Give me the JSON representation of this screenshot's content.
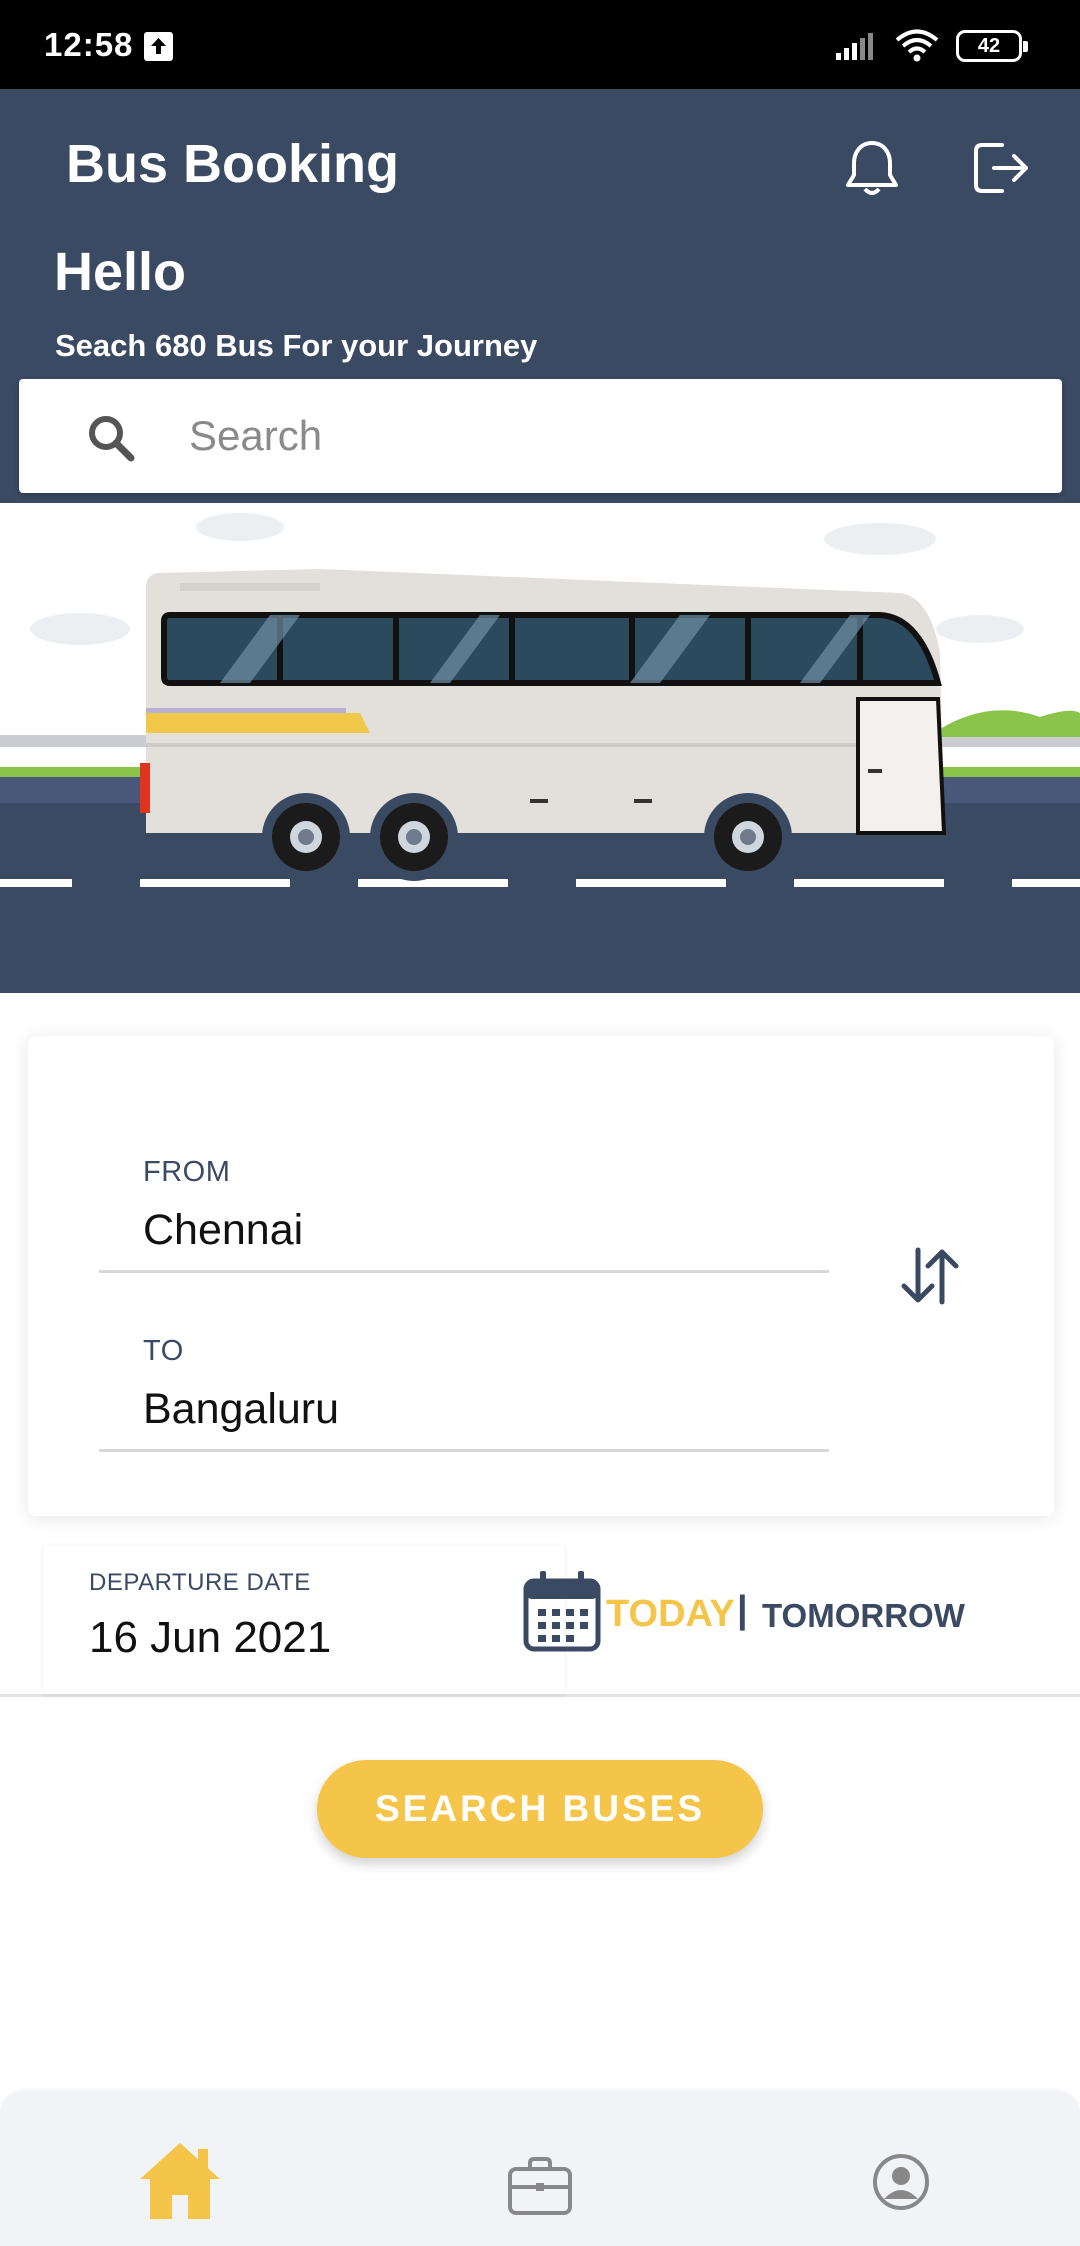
{
  "status_bar": {
    "time": "12:58",
    "battery": "42",
    "icons": [
      "upload-icon",
      "signal-icon",
      "wifi-icon",
      "battery-icon"
    ]
  },
  "header": {
    "title": "Bus Booking",
    "greeting": "Hello",
    "subtitle": "Seach 680 Bus For your Journey",
    "icons": [
      "bell-icon",
      "logout-icon"
    ]
  },
  "search": {
    "placeholder": "Search",
    "value": ""
  },
  "route": {
    "from_label": "FROM",
    "from_value": "Chennai",
    "to_label": "TO",
    "to_value": "Bangaluru"
  },
  "departure": {
    "label": "DEPARTURE DATE",
    "value": "16 Jun 2021",
    "today": "TODAY",
    "separator": "|",
    "tomorrow": "TOMORROW"
  },
  "actions": {
    "search_buses": "SEARCH BUSES"
  },
  "bottom_nav": {
    "items": [
      "home-icon",
      "briefcase-icon",
      "profile-icon"
    ]
  },
  "colors": {
    "header_bg": "#3b4a63",
    "accent": "#f5c54a",
    "text_dark": "#3b4a63"
  }
}
